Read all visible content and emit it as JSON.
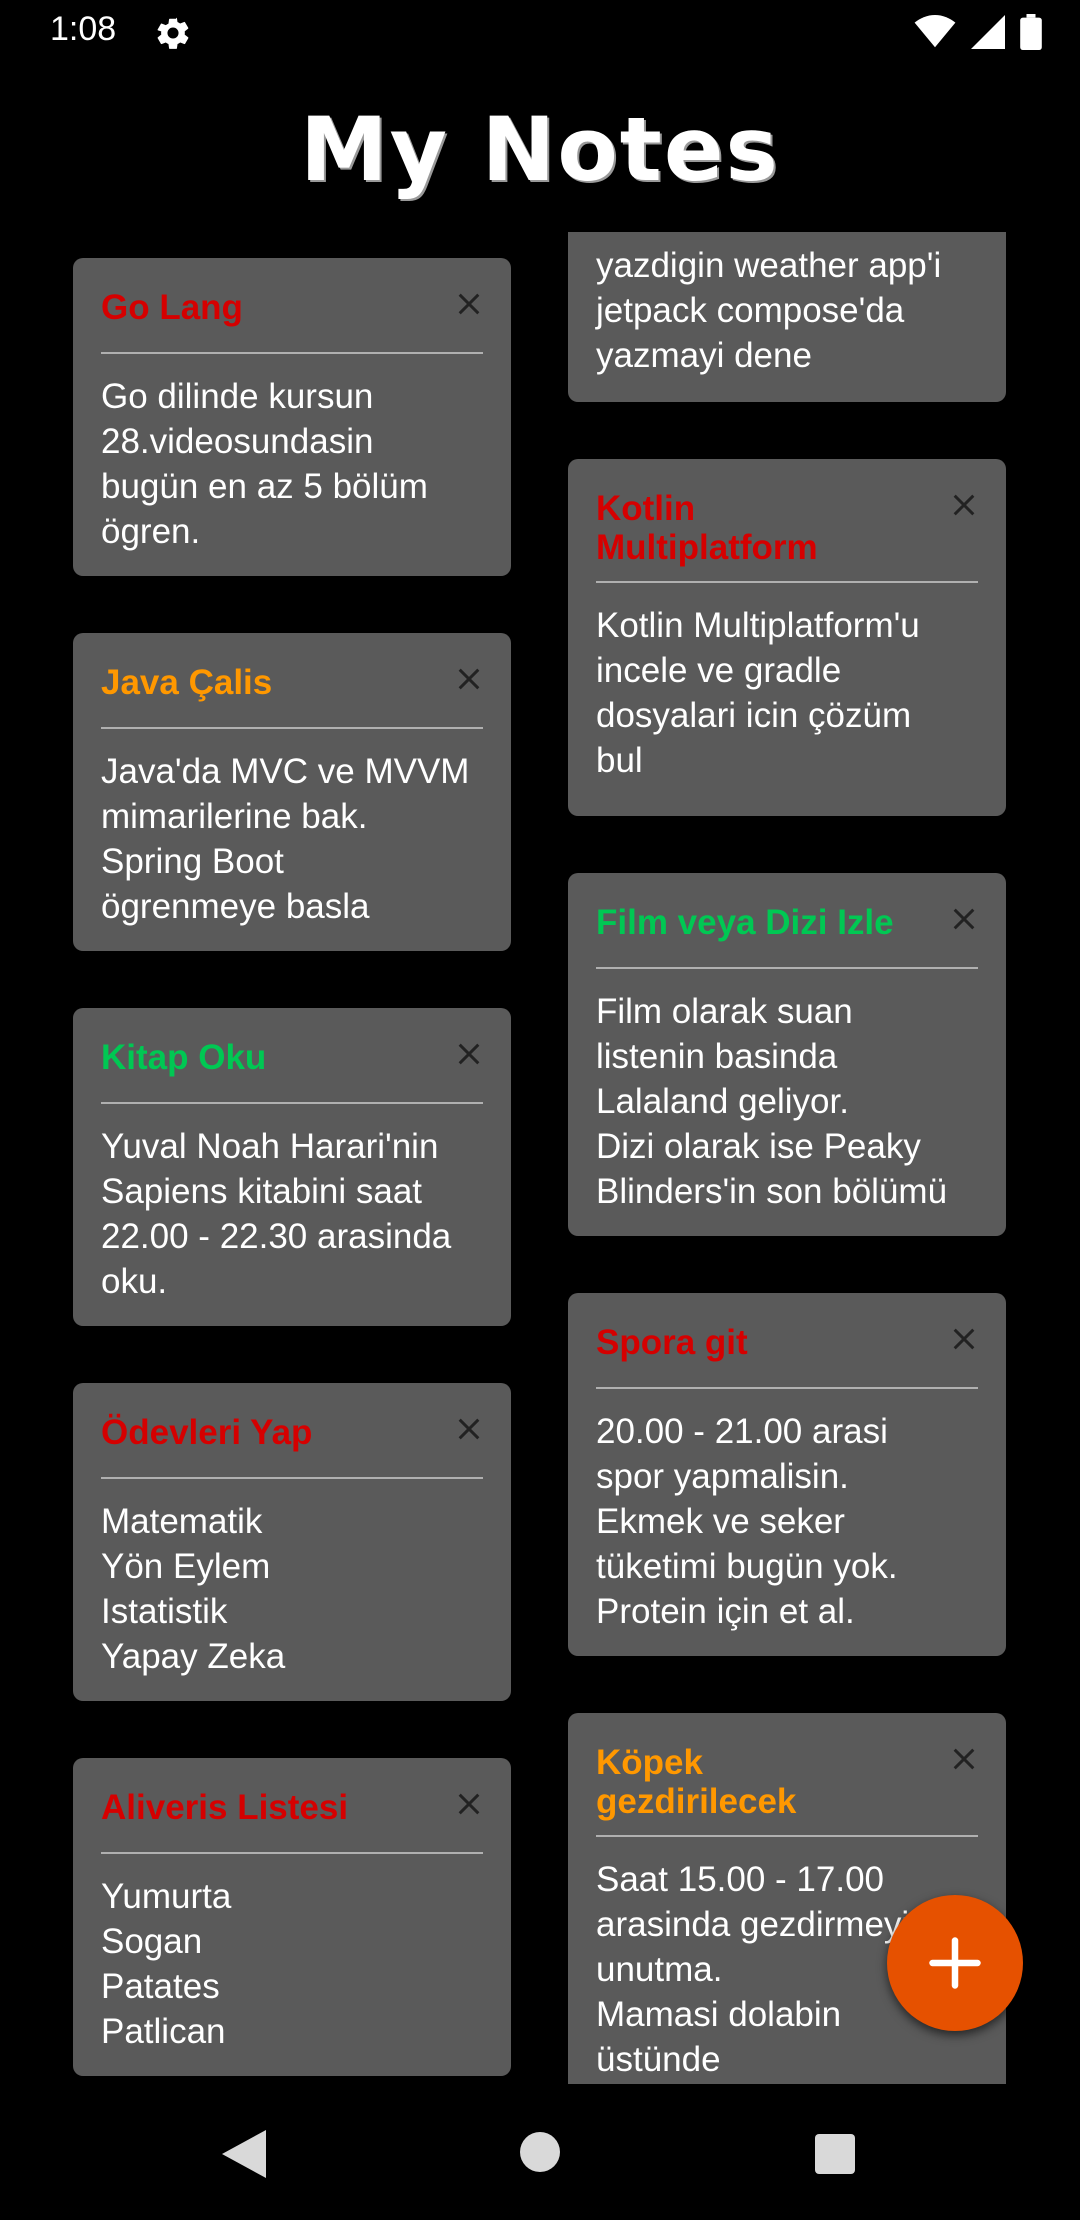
{
  "status_bar": {
    "time": "1:08"
  },
  "app": {
    "title": "My Notes"
  },
  "colors": {
    "red": "#d50000",
    "orange": "#ff9800",
    "green": "#00c853",
    "card": "#5a5a5a",
    "fab": "#e65100"
  },
  "notes_left": [
    {
      "title": "Go Lang",
      "color": "#d50000",
      "body": "Go dilinde kursun\n28.videosundasin\nbugün en az 5 bölüm\nögren."
    },
    {
      "title": "Java Çalis",
      "color": "#ff9800",
      "body": "Java'da MVC ve MVVM\nmimarilerine bak.\nSpring Boot\nögrenmeye basla"
    },
    {
      "title": "Kitap Oku",
      "color": "#00c853",
      "body": "Yuval Noah Harari'nin\nSapiens kitabini saat\n22.00 - 22.30 arasinda\noku."
    },
    {
      "title": "Ödevleri Yap",
      "color": "#d50000",
      "body": "Matematik\nYön Eylem\nIstatistik\nYapay Zeka"
    },
    {
      "title": "Aliveris Listesi",
      "color": "#d50000",
      "body": "Yumurta\nSogan\nPatates\nPatlican"
    }
  ],
  "notes_right": [
    {
      "title": "",
      "color": "#d50000",
      "body": "yazdigin weather app'i\njetpack compose'da\nyazmayi dene"
    },
    {
      "title": "Kotlin\nMultiplatform",
      "color": "#d50000",
      "body": "Kotlin Multiplatform'u\nincele ve gradle\ndosyalari icin çözüm\nbul"
    },
    {
      "title": "Film veya Dizi Izle",
      "color": "#00c853",
      "body": "Film olarak suan\nlistenin basinda\nLalaland geliyor.\nDizi olarak ise Peaky\nBlinders'in son bölümü"
    },
    {
      "title": "Spora git",
      "color": "#d50000",
      "body": "20.00 - 21.00 arasi\nspor yapmalisin.\nEkmek ve seker\ntüketimi bugün yok.\nProtein için et al."
    },
    {
      "title": "Köpek\ngezdirilecek",
      "color": "#ff9800",
      "body": "Saat 15.00 - 17.00\narasinda gezdirmeyi\nunutma.\nMamasi dolabin\nüstünde"
    }
  ]
}
